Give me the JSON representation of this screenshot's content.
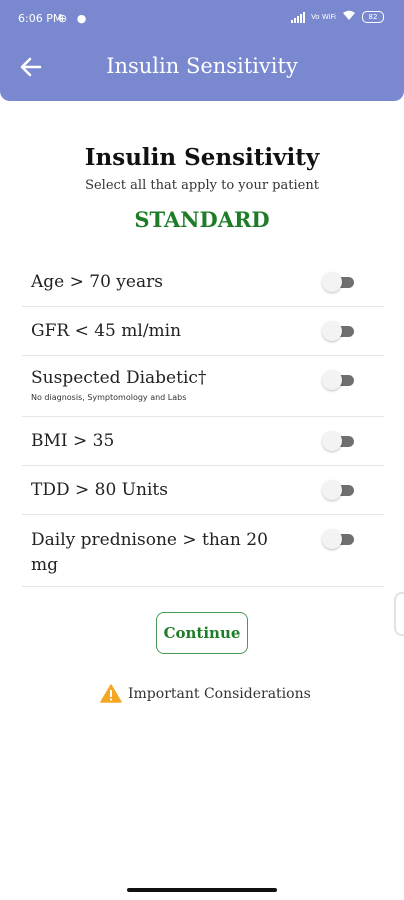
{
  "status_bar": {
    "time": "6:06 PM",
    "left_icons": "⊕ ●",
    "vowifi": "Vo WiFi",
    "battery": "82"
  },
  "app_bar": {
    "title": "Insulin Sensitivity"
  },
  "main": {
    "heading": "Insulin Sensitivity",
    "subheading": "Select all that apply to your patient",
    "status": "STANDARD",
    "status_color": "#1e7c28"
  },
  "criteria": [
    {
      "label": "Age > 70 years",
      "sub": "",
      "on": false
    },
    {
      "label": "GFR < 45 ml/min",
      "sub": "",
      "on": false
    },
    {
      "label": "Suspected Diabetic†",
      "sub": "No diagnosis, Symptomology and Labs",
      "on": false
    },
    {
      "label": "BMI > 35",
      "sub": "",
      "on": false
    },
    {
      "label": "TDD > 80 Units",
      "sub": "",
      "on": false
    },
    {
      "label": "Daily prednisone > than 20 mg",
      "sub": "",
      "on": false
    }
  ],
  "actions": {
    "continue_label": "Continue",
    "considerations_label": "Important Considerations"
  },
  "colors": {
    "app_bar": "#7a88cf",
    "accent_green": "#1e7c28",
    "warning": "#f5a623"
  }
}
